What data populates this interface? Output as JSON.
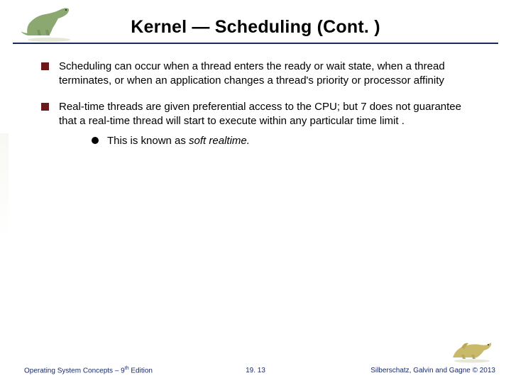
{
  "title": "Kernel — Scheduling (Cont. )",
  "bullets": [
    "Scheduling can occur when a thread enters the ready or wait state, when a thread terminates, or when an application changes a thread's priority or processor affinity",
    "Real-time threads are given preferential access to the CPU; but 7 does not guarantee that a real-time thread will start to execute within any particular time limit ."
  ],
  "sub_prefix": "This is known as ",
  "sub_italic": "soft realtime.",
  "footer": {
    "left_a": "Operating System Concepts – 9",
    "left_b": " Edition",
    "left_sup": "th",
    "center": "19. 13",
    "right": "Silberschatz, Galvin and Gagne © 2013"
  }
}
